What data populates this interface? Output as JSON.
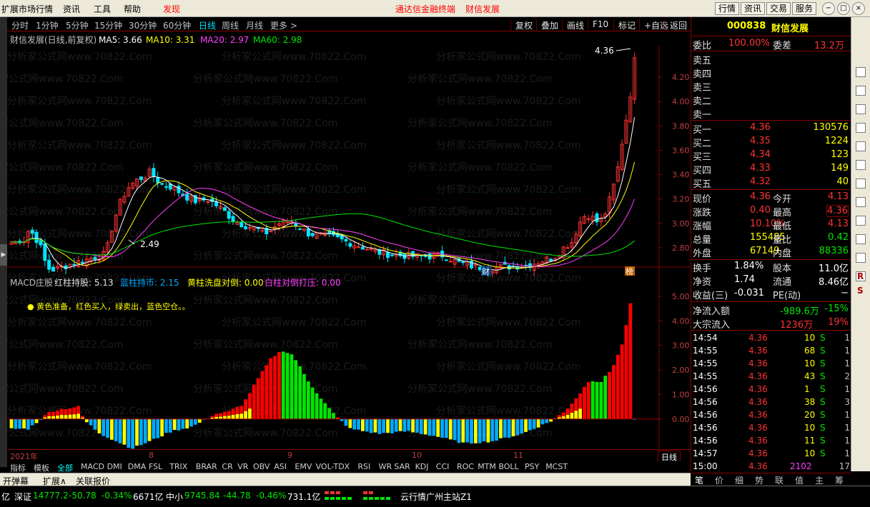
{
  "menu": {
    "items": [
      "扩展市场行情",
      "资讯",
      "工具",
      "帮助",
      "发现"
    ],
    "center": [
      "通达信金融终端",
      "财信发展"
    ],
    "right_buttons": [
      "行情",
      "资讯",
      "交易",
      "服务"
    ],
    "window_buttons": [
      "−",
      "□",
      "×"
    ]
  },
  "periods": {
    "items": [
      "分时",
      "1分钟",
      "5分钟",
      "15分钟",
      "30分钟",
      "60分钟",
      "日线",
      "周线",
      "月线",
      "更多 >"
    ],
    "active": "日线",
    "tools": [
      "复权",
      "叠加",
      "画线",
      "F10",
      "标记",
      "+自选",
      "返回"
    ]
  },
  "main_legend": {
    "title": "财信发展(日线,前复权)",
    "ma5": "MA5: 3.66",
    "ma10": "MA10: 3.31",
    "ma20": "MA20: 2.97",
    "ma60": "MA60: 2.98"
  },
  "macd_legend": {
    "title": "MACD庄股",
    "hz": "红柱持股: 5.13",
    "lz": "蓝柱持币: 2.15",
    "hx": "黄柱洗盘对倒: 0.00",
    "bd": "白柱对倒打压: 0.00",
    "note": "● 黄色准备，红色买入，绿卖出，蓝色空仓。。"
  },
  "watermark": "分析家公式网www.70822.Com",
  "colors": {
    "up": "#ff3232",
    "down": "#00e5ff",
    "ma5": "#ffffff",
    "ma10": "#ffff00",
    "ma20": "#ff40ff",
    "ma60": "#00e600",
    "red_bar": "#ff0000",
    "green_bar": "#00e600",
    "yellow_bar": "#ffff00",
    "blue_bar": "#00aaff",
    "grid": "#800000"
  },
  "chart_data": {
    "type": "candlestick",
    "yaxis": {
      "min": 2.7,
      "max": 4.4,
      "ticks": [
        "4.20",
        "4.00",
        "3.80",
        "3.60",
        "3.40",
        "3.20",
        "3.00",
        "2.80"
      ]
    },
    "markers": {
      "high": "4.36",
      "low": "2.49",
      "cai": "财",
      "bang": "榜"
    },
    "xaxis": {
      "labels": [
        "2021年",
        "8",
        "9",
        "10",
        "11"
      ],
      "period": "日线"
    },
    "macd_axis": {
      "min": -1.2,
      "max": 5.2,
      "ticks": [
        "5.00",
        "4.00",
        "3.00",
        "2.00",
        "1.00",
        "0.00"
      ]
    }
  },
  "quote": {
    "code": "000838",
    "name": "财信发展",
    "weibi_label": "委比",
    "weibi": "100.00%",
    "weicha_label": "委差",
    "weicha": "13.2万",
    "sells": [
      {
        "label": "卖五"
      },
      {
        "label": "卖四"
      },
      {
        "label": "卖三"
      },
      {
        "label": "卖二"
      },
      {
        "label": "卖一"
      }
    ],
    "buys": [
      {
        "label": "买一",
        "price": "4.36",
        "vol": "130576"
      },
      {
        "label": "买二",
        "price": "4.35",
        "vol": "1224"
      },
      {
        "label": "买三",
        "price": "4.34",
        "vol": "123"
      },
      {
        "label": "买四",
        "price": "4.33",
        "vol": "149"
      },
      {
        "label": "买五",
        "price": "4.32",
        "vol": "40"
      }
    ],
    "stats": [
      {
        "l1": "现价",
        "v1": "4.36",
        "l2": "今开",
        "v2": "4.13"
      },
      {
        "l1": "涨跌",
        "v1": "0.40",
        "l2": "最高",
        "v2": "4.36"
      },
      {
        "l1": "涨幅",
        "v1": "10.10%",
        "l2": "最低",
        "v2": "4.13"
      },
      {
        "l1": "总量",
        "v1": "155485",
        "l2": "量比",
        "v2": "0.42"
      },
      {
        "l1": "外盘",
        "v1": "67149",
        "l2": "内盘",
        "v2": "88336"
      }
    ],
    "stats2": [
      {
        "l1": "换手",
        "v1": "1.84%",
        "l2": "股本",
        "v2": "11.0亿"
      },
      {
        "l1": "净资",
        "v1": "1.74",
        "l2": "流通",
        "v2": "8.46亿"
      },
      {
        "l1": "收益(三)",
        "v1": "-0.031",
        "l2": "PE(动)",
        "v2": "−"
      }
    ],
    "flow": [
      {
        "l": "净流入额",
        "v": "-989.6万",
        "p": "-15%"
      },
      {
        "l": "大宗流入",
        "v": "1236万",
        "p": "19%"
      }
    ],
    "ticks": [
      {
        "t": "14:54",
        "p": "4.36",
        "v": "10",
        "s": "S",
        "n": "1"
      },
      {
        "t": "14:55",
        "p": "4.36",
        "v": "68",
        "s": "S",
        "n": "1"
      },
      {
        "t": "14:55",
        "p": "4.36",
        "v": "10",
        "s": "S",
        "n": "1"
      },
      {
        "t": "14:55",
        "p": "4.36",
        "v": "43",
        "s": "S",
        "n": "2"
      },
      {
        "t": "14:56",
        "p": "4.36",
        "v": "1",
        "s": "S",
        "n": "1"
      },
      {
        "t": "14:56",
        "p": "4.36",
        "v": "38",
        "s": "S",
        "n": "3"
      },
      {
        "t": "14:56",
        "p": "4.36",
        "v": "20",
        "s": "S",
        "n": "1"
      },
      {
        "t": "14:56",
        "p": "4.36",
        "v": "10",
        "s": "S",
        "n": "1"
      },
      {
        "t": "14:56",
        "p": "4.36",
        "v": "11",
        "s": "S",
        "n": "1"
      },
      {
        "t": "14:57",
        "p": "4.36",
        "v": "10",
        "s": "S",
        "n": "1"
      },
      {
        "t": "15:00",
        "p": "4.36",
        "v": "2102",
        "s": "",
        "n": "17"
      }
    ]
  },
  "rtabs": [
    "笔",
    "价",
    "细",
    "势",
    "联",
    "值",
    "主",
    "筹"
  ],
  "indicators": [
    "指标",
    "模板",
    "全部",
    "MACD",
    "DMI",
    "DMA",
    "FSL",
    "TRIX",
    "BRAR",
    "CR",
    "VR",
    "OBV",
    "ASI",
    "EMV",
    "VOL-TDX",
    "RSI",
    "WR",
    "SAR",
    "KDJ",
    "CCI",
    "ROC",
    "MTM",
    "BOLL",
    "PSY",
    "MCST"
  ],
  "bottom_tabs": [
    "开弹幕",
    "扩展∧",
    "关联报价"
  ],
  "status": {
    "a": "亿",
    "sz_label": "深证",
    "sz": "14777.2",
    "sz_chg": "-50.78",
    "sz_pct": "-0.34%",
    "sz_amt": "6671亿",
    "zx_label": "中小",
    "zx": "9745.84",
    "zx_chg": "-44.78",
    "zx_pct": "-0.46%",
    "zx_amt": "731.1亿",
    "server": "云行情广州主站Z1"
  },
  "toolstrip_letters": [
    "R",
    "S"
  ]
}
